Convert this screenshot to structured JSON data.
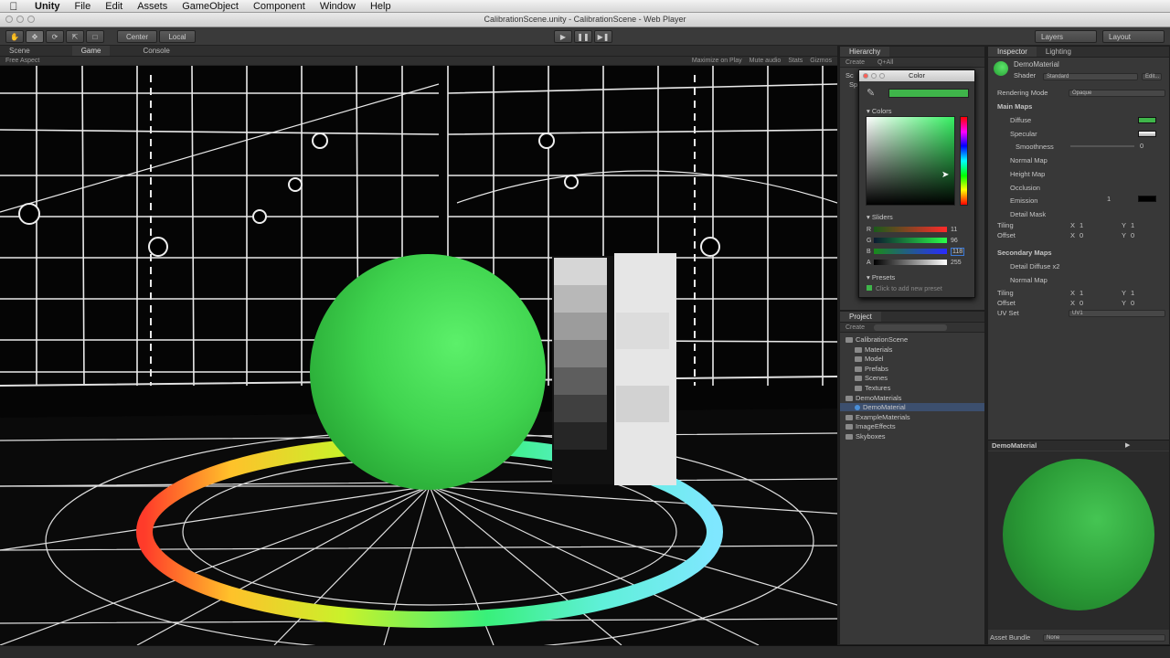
{
  "menubar": {
    "app": "Unity",
    "items": [
      "File",
      "Edit",
      "Assets",
      "GameObject",
      "Component",
      "Window",
      "Help"
    ]
  },
  "window": {
    "title": "CalibrationScene.unity - CalibrationScene - Web Player"
  },
  "toolbar": {
    "center": "Center",
    "local": "Local",
    "layers": "Layers",
    "layout": "Layout"
  },
  "scene_tabs": {
    "scene": "Scene",
    "game": "Game",
    "console": "Console",
    "aspect": "Free Aspect",
    "maximize": "Maximize on Play",
    "mute": "Mute audio",
    "stats": "Stats",
    "gizmos": "Gizmos"
  },
  "hierarchy": {
    "title": "Hierarchy",
    "create": "Create",
    "all": "Q+All",
    "items": [
      "Sc",
      "Sp"
    ]
  },
  "color_picker": {
    "title": "Color",
    "colors_label": "Colors",
    "sliders_label": "Sliders",
    "presets_label": "Presets",
    "add_preset": "Click to add new preset",
    "current": "#3fb54a",
    "sliders": [
      {
        "label": "R",
        "value": "11"
      },
      {
        "label": "G",
        "value": "96"
      },
      {
        "label": "B",
        "value": "118"
      },
      {
        "label": "A",
        "value": "255"
      }
    ]
  },
  "project": {
    "title": "Project",
    "create": "Create",
    "tree": [
      {
        "label": "CalibrationScene",
        "level": 0
      },
      {
        "label": "Materials",
        "level": 1
      },
      {
        "label": "Model",
        "level": 1
      },
      {
        "label": "Prefabs",
        "level": 1
      },
      {
        "label": "Scenes",
        "level": 1
      },
      {
        "label": "Textures",
        "level": 1
      },
      {
        "label": "DemoMaterials",
        "level": 0
      },
      {
        "label": "DemoMaterial",
        "level": 1,
        "selected": true
      },
      {
        "label": "ExampleMaterials",
        "level": 0
      },
      {
        "label": "ImageEffects",
        "level": 0
      },
      {
        "label": "Skyboxes",
        "level": 0
      }
    ]
  },
  "inspector": {
    "tab": "Inspector",
    "lighting_tab": "Lighting",
    "material": "DemoMaterial",
    "shader_label": "Shader",
    "shader_value": "Standard",
    "edit": "Edit...",
    "rendering_mode_label": "Rendering Mode",
    "rendering_mode": "Opaque",
    "main_maps": "Main Maps",
    "maps": [
      "Diffuse",
      "Specular",
      "Smoothness",
      "Normal Map",
      "Height Map",
      "Occlusion",
      "Emission",
      "Detail Mask"
    ],
    "emission_value": "1",
    "smoothness_value": "0",
    "tiling": "Tiling",
    "offset": "Offset",
    "x": "X",
    "y": "Y",
    "one": "1",
    "zero": "0",
    "secondary_maps": "Secondary Maps",
    "sec_maps": [
      "Detail Diffuse x2",
      "Normal Map"
    ],
    "uv_set": "UV Set",
    "uv_value": "UV1",
    "preview_title": "DemoMaterial",
    "asset_bundle": "Asset Bundle",
    "asset_bundle_value": "None"
  },
  "colors": {
    "sphere": "#3fcf4f",
    "bg": "#383838",
    "accent": "#3d7bd8"
  }
}
